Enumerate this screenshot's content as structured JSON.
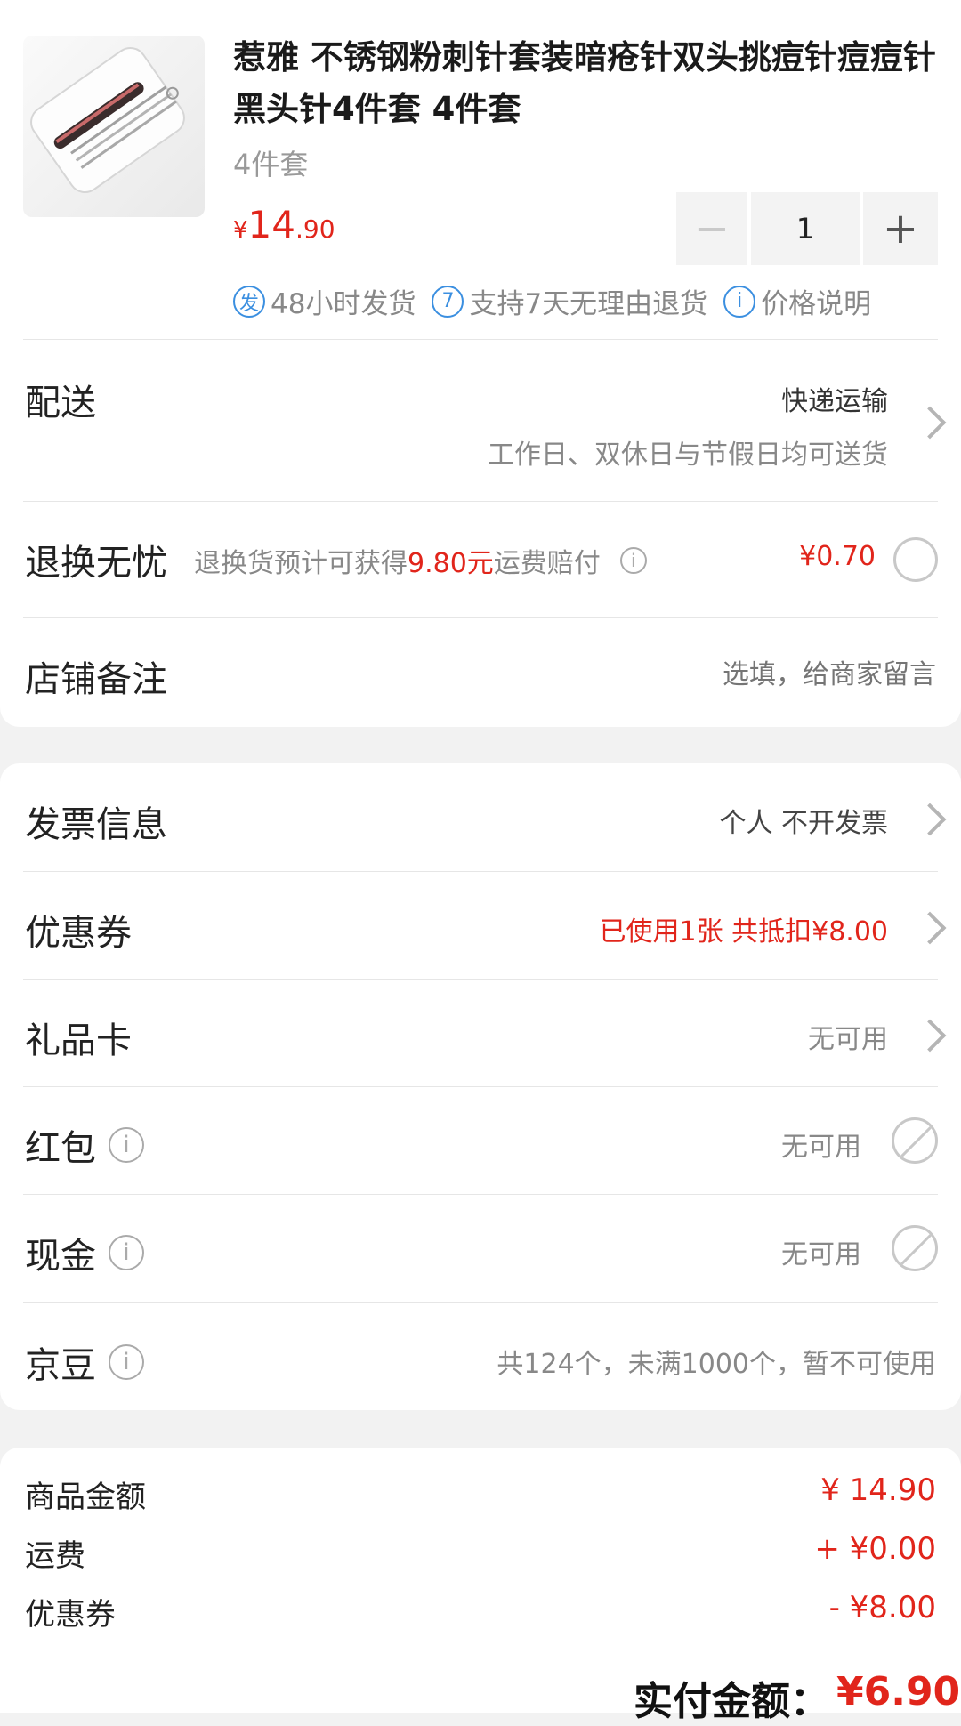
{
  "product": {
    "title": "惹雅 不锈钢粉刺针套装暗疮针双头挑痘针痘痘针黑头针4件套 4件套",
    "spec": "4件套",
    "price_currency": "¥",
    "price_integer": "14",
    "price_decimal": ".90",
    "quantity": "1",
    "minus_label": "−",
    "plus_label": "+",
    "badges": [
      {
        "icon": "发",
        "text": "48小时发货"
      },
      {
        "icon": "7",
        "text": "支持7天无理由退货"
      },
      {
        "icon": "i",
        "text": "价格说明"
      }
    ]
  },
  "delivery": {
    "label": "配送",
    "method": "快递运输",
    "note": "工作日、双休日与节假日均可送货"
  },
  "returns": {
    "label": "退换无忧",
    "desc_prefix": "退换货预计可获得",
    "desc_amount": "9.80元",
    "desc_suffix": "运费赔付",
    "price": "¥0.70"
  },
  "remark": {
    "label": "店铺备注",
    "placeholder": "选填，给商家留言"
  },
  "invoice": {
    "label": "发票信息",
    "value": "个人 不开发票"
  },
  "coupon": {
    "label": "优惠券",
    "value": "已使用1张 共抵扣¥8.00"
  },
  "giftcard": {
    "label": "礼品卡",
    "value": "无可用"
  },
  "hongbao": {
    "label": "红包",
    "value": "无可用"
  },
  "cash": {
    "label": "现金",
    "value": "无可用"
  },
  "jingdou": {
    "label": "京豆",
    "value": "共124个，未满1000个，暂不可使用"
  },
  "summary": {
    "goods_label": "商品金额",
    "goods_value": "¥ 14.90",
    "shipping_label": "运费",
    "shipping_value": "+ ¥0.00",
    "coupon_label": "优惠券",
    "coupon_value": "- ¥8.00",
    "pay_label": "实付金额：",
    "pay_value": "¥6.90"
  },
  "colors": {
    "accent": "#e1251b",
    "badge_blue": "#3b8fe0",
    "background": "#f2f2f2"
  }
}
